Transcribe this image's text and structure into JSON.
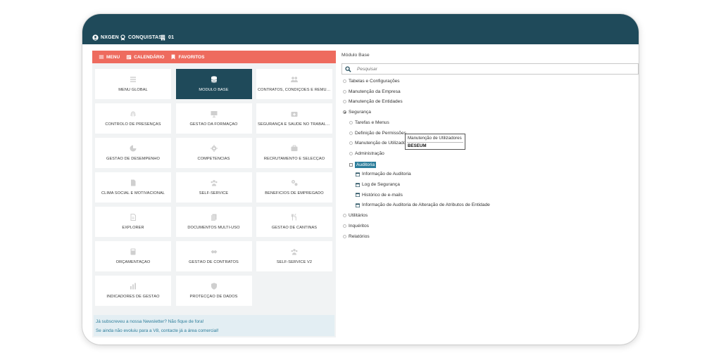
{
  "topbar": {
    "user": "NXGEN",
    "conquistas": "CONQUISTAS",
    "badge_count": "01"
  },
  "menubar": {
    "menu": "MENU",
    "calendario": "CALENDÁRIO",
    "favoritos": "FAVORITOS"
  },
  "modules": [
    {
      "label": "MENU GLOBAL",
      "icon": "list-icon"
    },
    {
      "label": "MÓDULO BASE",
      "icon": "database-icon"
    },
    {
      "label": "CONTRATOS, CONDIÇÕES E REMUNER...",
      "icon": "people-icon"
    },
    {
      "label": "CONTROLO DE PRESENÇAS",
      "icon": "fingerprint-icon"
    },
    {
      "label": "GESTÃO DA FORMAÇÃO",
      "icon": "presentation-icon"
    },
    {
      "label": "SEGURANÇA E SAÚDE NO TRABALHO",
      "icon": "medkit-icon"
    },
    {
      "label": "GESTÃO DE DESEMPENHO",
      "icon": "chart-icon"
    },
    {
      "label": "COMPETÊNCIAS",
      "icon": "gear-icon"
    },
    {
      "label": "RECRUTAMENTO E SELECÇÃO",
      "icon": "briefcase-icon"
    },
    {
      "label": "CLIMA SOCIAL E MOTIVACIONAL",
      "icon": "document-icon"
    },
    {
      "label": "SELF-SERVICE",
      "icon": "group-icon"
    },
    {
      "label": "BENEFÍCIOS DE EMPREGADO",
      "icon": "gears-icon"
    },
    {
      "label": "EXPLORER",
      "icon": "file-icon"
    },
    {
      "label": "DOCUMENTOS MULTI-USO",
      "icon": "documents-icon"
    },
    {
      "label": "GESTÃO DE CANTINAS",
      "icon": "cutlery-icon"
    },
    {
      "label": "ORÇAMENTAÇÃO",
      "icon": "calculator-icon"
    },
    {
      "label": "GESTÃO DE CONTRATOS",
      "icon": "handshake-icon"
    },
    {
      "label": "SELF-SERVICE V2",
      "icon": "group-icon"
    },
    {
      "label": "INDICADORES DE GESTÃO",
      "icon": "bars-icon"
    },
    {
      "label": "PROTECÇÃO DE DADOS",
      "icon": "shield-icon"
    }
  ],
  "active_module": "MÓDULO BASE",
  "news": {
    "line1": "Já subscreveu a nossa Newsletter? Não fique de fora!",
    "line2": "Se ainda não evoluiu para a V8, contacte já a área comercial!"
  },
  "panel": {
    "title": "Módulo Base",
    "search_placeholder": "Pesquisar",
    "tree": [
      {
        "label": "Tabelas e Configurações",
        "level": 0,
        "marker": "bullet"
      },
      {
        "label": "Manutenção da Empresa",
        "level": 0,
        "marker": "bullet"
      },
      {
        "label": "Manutenção de Entidades",
        "level": 0,
        "marker": "bullet"
      },
      {
        "label": "Segurança",
        "level": 0,
        "marker": "bullet-open"
      },
      {
        "label": "Tarefas e Menus",
        "level": 1,
        "marker": "bullet"
      },
      {
        "label": "Definição de Permissões",
        "level": 1,
        "marker": "bullet"
      },
      {
        "label": "Manutenção de Utilizadores",
        "level": 1,
        "marker": "bullet"
      },
      {
        "label": "Administração",
        "level": 1,
        "marker": "bullet"
      },
      {
        "label": "Auditoria",
        "level": 1,
        "marker": "square",
        "highlight": true
      },
      {
        "label": "Informação de Auditoria",
        "level": 2,
        "marker": "calendar"
      },
      {
        "label": "Log de Segurança",
        "level": 2,
        "marker": "calendar"
      },
      {
        "label": "Histórico de e-mails",
        "level": 2,
        "marker": "calendar"
      },
      {
        "label": "Informação de Auditoria de Alteração de Atributos de Entidade",
        "level": 2,
        "marker": "calendar"
      },
      {
        "label": "Utilitários",
        "level": 0,
        "marker": "bullet"
      },
      {
        "label": "Inquéritos",
        "level": 0,
        "marker": "bullet"
      },
      {
        "label": "Relatórios",
        "level": 0,
        "marker": "bullet"
      }
    ],
    "tooltip": {
      "title": "Manutenção de Utilizadores",
      "value": "BESEUM"
    }
  },
  "colors": {
    "topbar": "#1f4a5a",
    "menubar": "#ee6b5e",
    "highlight": "#2e7e9b"
  }
}
